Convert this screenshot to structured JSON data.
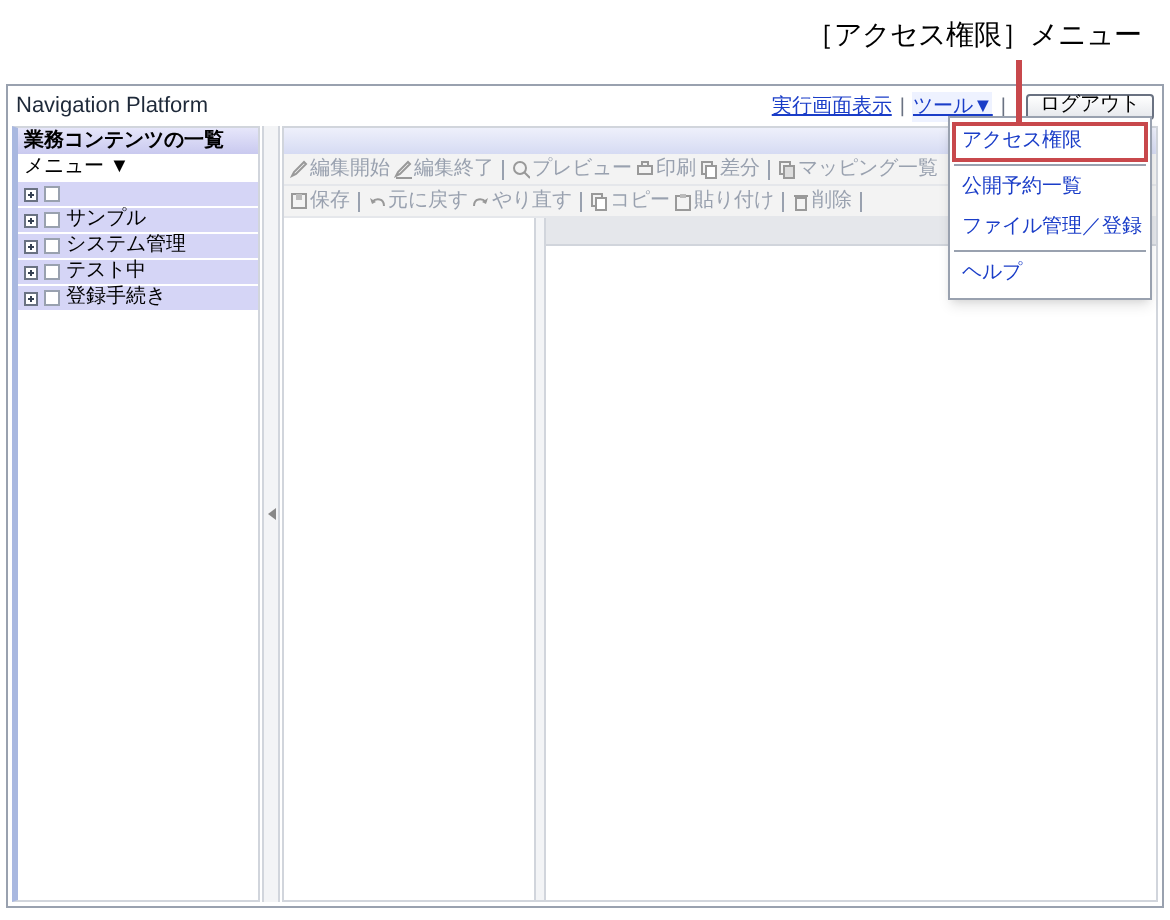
{
  "callout": {
    "text": "［アクセス権限］メニュー"
  },
  "window": {
    "title": "Navigation Platform",
    "header_links": [
      {
        "kind": "link",
        "label": "実行画面表示"
      },
      {
        "kind": "divider",
        "label": "|"
      },
      {
        "kind": "menu",
        "label": "ツール▼",
        "expanded": true
      },
      {
        "kind": "divider",
        "label": "|"
      }
    ],
    "logout_button": "ログアウト"
  },
  "sidebar": {
    "title": "業務コンテンツの一覧",
    "menu": "メニュー ▼",
    "tree": [
      {
        "checked": false,
        "expanded": false
      },
      {
        "label": "サンプル",
        "checked": false,
        "expanded": false
      },
      {
        "label": "システム管理",
        "checked": false,
        "expanded": false
      },
      {
        "label": "テスト中",
        "checked": false,
        "expanded": false
      },
      {
        "label": "登録手続き",
        "checked": false,
        "expanded": false
      }
    ]
  },
  "toolbars": [
    {
      "items": [
        {
          "kind": "button",
          "label": "編集開始",
          "disabled": true
        },
        {
          "kind": "button",
          "label": "編集終了",
          "disabled": true
        },
        {
          "kind": "separator"
        },
        {
          "kind": "button",
          "label": "プレビュー",
          "disabled": true
        },
        {
          "kind": "button",
          "label": "印刷",
          "disabled": true
        },
        {
          "kind": "button",
          "label": "差分",
          "disabled": true
        },
        {
          "kind": "separator"
        },
        {
          "kind": "button",
          "label": "マッピング一覧",
          "disabled": true
        }
      ]
    },
    {
      "items": [
        {
          "kind": "button",
          "label": "保存",
          "disabled": true
        },
        {
          "kind": "separator"
        },
        {
          "kind": "button",
          "label": "元に戻す",
          "disabled": true
        },
        {
          "kind": "button",
          "label": "やり直す",
          "disabled": true
        },
        {
          "kind": "separator"
        },
        {
          "kind": "button",
          "label": "コピー",
          "disabled": true
        },
        {
          "kind": "button",
          "label": "貼り付け",
          "disabled": true
        },
        {
          "kind": "separator"
        },
        {
          "kind": "button",
          "label": "削除",
          "disabled": true
        },
        {
          "kind": "separator"
        }
      ]
    }
  ],
  "tools_menu": {
    "items": [
      {
        "kind": "item",
        "label": "アクセス権限",
        "highlighted": true
      },
      {
        "kind": "separator"
      },
      {
        "kind": "item",
        "label": "公開予約一覧",
        "highlighted": false
      },
      {
        "kind": "item",
        "label": "ファイル管理／登録",
        "highlighted": false
      },
      {
        "kind": "separator"
      },
      {
        "kind": "item",
        "label": "ヘルプ",
        "highlighted": false
      }
    ]
  }
}
